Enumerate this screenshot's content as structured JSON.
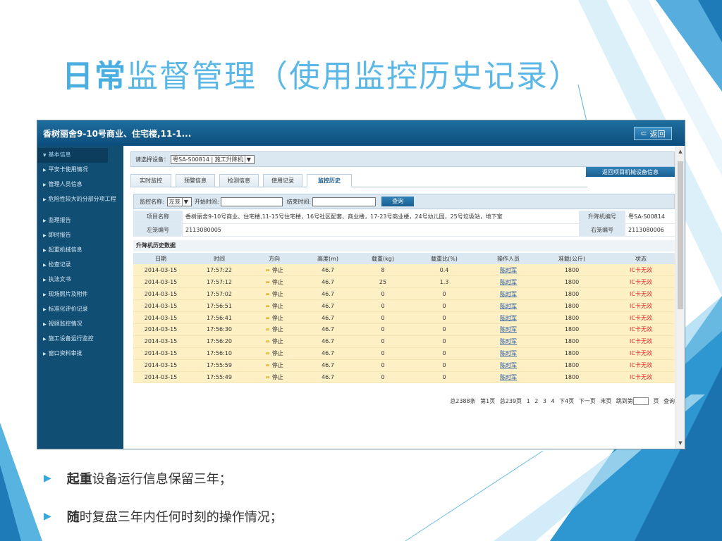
{
  "slide": {
    "title_bold": "日常",
    "title_rest": "监督管理（使用监控历史记录）",
    "bullets": [
      {
        "bold": "起重",
        "rest": "设备运行信息保留三年；"
      },
      {
        "bold": "随",
        "rest": "时复盘三年内任何时刻的操作情况；"
      }
    ]
  },
  "app": {
    "title": "香树丽舍9-10号商业、住宅楼,11-1...",
    "back_label": "返回",
    "sidebar": [
      "基本信息",
      "平安卡使用情况",
      "管理人员信息",
      "危险性较大的分部分项工程",
      "监理报告",
      "即时报告",
      "起重机械信息",
      "检查记录",
      "执法文书",
      "现场照片及附件",
      "标准化评价记录",
      "视频监控情况",
      "施工设备运行监控",
      "窗口资料审批"
    ],
    "device_label": "请选择设备：",
    "device_value": "粤SA-S00814 | 施工升降机",
    "return_button": "返回项目机械设备信息",
    "tabs": [
      "实时监控",
      "预警信息",
      "检测信息",
      "使用记录",
      "监控历史"
    ],
    "filter": {
      "monitor_label": "监控名称:",
      "monitor_value": "左笼",
      "start_label": "开始时间:",
      "end_label": "结束时间:",
      "query": "查询"
    },
    "info": {
      "project_label": "项目名称",
      "project_value": "香树丽舍9-10号商业、住宅楼,11-15号住宅楼，16号社区配套、商业楼，17-23号商业楼，24号幼儿园，25号垃圾站，地下室",
      "elevator_label": "升降机编号",
      "elevator_value": "粤SA-S00814",
      "left_label": "左笼编号",
      "left_value": "2113080005",
      "right_label": "右笼编号",
      "right_value": "2113080006"
    },
    "history_title": "升降机历史数据",
    "history_headers": [
      "日期",
      "时间",
      "方向",
      "高度(m)",
      "载重(kg)",
      "载重比(%)",
      "操作人员",
      "准载(公斤)",
      "状态"
    ],
    "history_rows": [
      [
        "2014-03-15",
        "17:57:22",
        "停止",
        "46.7",
        "8",
        "0.4",
        "陈时军",
        "1800",
        "IC卡无效"
      ],
      [
        "2014-03-15",
        "17:57:12",
        "停止",
        "46.7",
        "25",
        "1.3",
        "陈时军",
        "1800",
        "IC卡无效"
      ],
      [
        "2014-03-15",
        "17:57:02",
        "停止",
        "46.7",
        "0",
        "0",
        "陈时军",
        "1800",
        "IC卡无效"
      ],
      [
        "2014-03-15",
        "17:56:51",
        "停止",
        "46.7",
        "0",
        "0",
        "陈时军",
        "1800",
        "IC卡无效"
      ],
      [
        "2014-03-15",
        "17:56:41",
        "停止",
        "46.7",
        "0",
        "0",
        "陈时军",
        "1800",
        "IC卡无效"
      ],
      [
        "2014-03-15",
        "17:56:30",
        "停止",
        "46.7",
        "0",
        "0",
        "陈时军",
        "1800",
        "IC卡无效"
      ],
      [
        "2014-03-15",
        "17:56:20",
        "停止",
        "46.7",
        "0",
        "0",
        "陈时军",
        "1800",
        "IC卡无效"
      ],
      [
        "2014-03-15",
        "17:56:10",
        "停止",
        "46.7",
        "0",
        "0",
        "陈时军",
        "1800",
        "IC卡无效"
      ],
      [
        "2014-03-15",
        "17:55:59",
        "停止",
        "46.7",
        "0",
        "0",
        "陈时军",
        "1800",
        "IC卡无效"
      ],
      [
        "2014-03-15",
        "17:55:49",
        "停止",
        "46.7",
        "0",
        "0",
        "陈时军",
        "1800",
        "IC卡无效"
      ]
    ],
    "pager": {
      "summary": "总2388条 第1页 总239页",
      "pages": [
        "1",
        "2",
        "3",
        "4"
      ],
      "next4": "下4页",
      "next": "下一页",
      "last": "末页",
      "jump": "跳到第",
      "page_suffix": "页",
      "go": "查询"
    }
  }
}
